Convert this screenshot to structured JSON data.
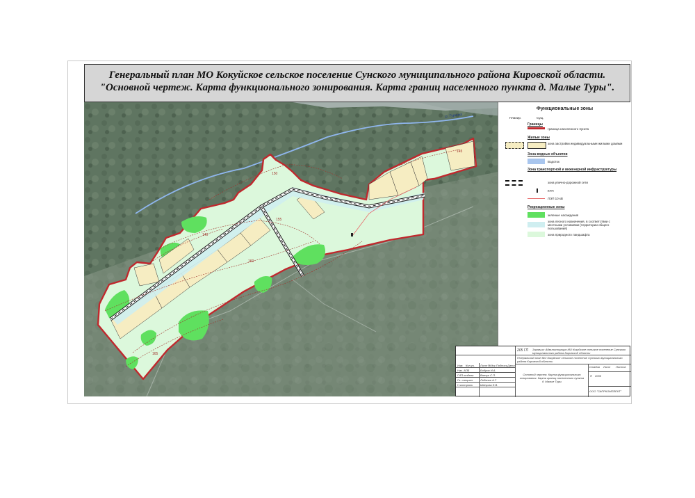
{
  "title": {
    "line1": "Генеральный план МО Кокуйское сельское поселение Сунского муниципального района Кировской области.",
    "line2": "\"Основной чертеж. Карта функционального зонирования. Карта границ населенного пункта д. Малые Туры\"."
  },
  "map": {
    "river_label": "р. Туринка",
    "contour_labels": [
      "165",
      "160",
      "155",
      "150",
      "145",
      "140"
    ]
  },
  "legend": {
    "title": "Функциональные зоны",
    "col_plan": "Планир.",
    "col_exist": "Сущ.",
    "sections": {
      "borders": "Границы",
      "residential": "Жилые зоны",
      "water": "Зона водных объектов",
      "transport": "Зона транспортной и инженерной инфраструктуры",
      "recreation": "Рекреационные зоны"
    },
    "items": {
      "boundary": "граница населенного пункта",
      "residential_zone": "зона застройки индивидуальными жилыми домами",
      "watercourse": "Водоток",
      "street_network": "зона улично-дорожной сети",
      "ktp": "КТП",
      "power_line": "ЛЭП 10 кВ",
      "green_space": "зеленые насаждения",
      "forest_public": "зона лесного назначения, в соответствии с местными условиями (территории общего пользования)",
      "natural_landscape": "зона природного ландшафта"
    },
    "colors": {
      "boundary": "#c0282d",
      "residential": "#f6edc2",
      "water": "#a9c6ee",
      "green_space": "#5fe05f",
      "forest_public": "#cfeef0",
      "natural_landscape": "#dcf8dc"
    }
  },
  "stamp": {
    "code": "205 ГП",
    "customer": "Заказчик: Администрация МО Кокуйское сельское поселение Сунского муниципального района Кировской области",
    "project": "Генеральный план МО Кокуйское сельское поселение Сунского муниципального района Кировской области",
    "sheet_title": "Основной чертеж. Карта функционального зонирования. Карта границ населенного пункта д. Малые Туры",
    "stage_label": "Стадия",
    "sheet_label": "Лист",
    "sheets_label": "Листов",
    "stage_value": "П",
    "year": "2009",
    "organization": "ООО \"САПРКОМПЛЕКТ\"",
    "header_row": [
      "Изм.",
      "Кол.уч.",
      "Лист",
      "№док.",
      "Подпись",
      "Дата"
    ],
    "staff": [
      {
        "role": "Нач. АПБ",
        "name": "Бобров И.А."
      },
      {
        "role": "ГИП отдела",
        "name": "Ванчук С.П."
      },
      {
        "role": "Гл. специал.",
        "name": "Лобанов А.Г."
      },
      {
        "role": "Н.контроль",
        "name": "Швецова Е.В."
      }
    ]
  }
}
